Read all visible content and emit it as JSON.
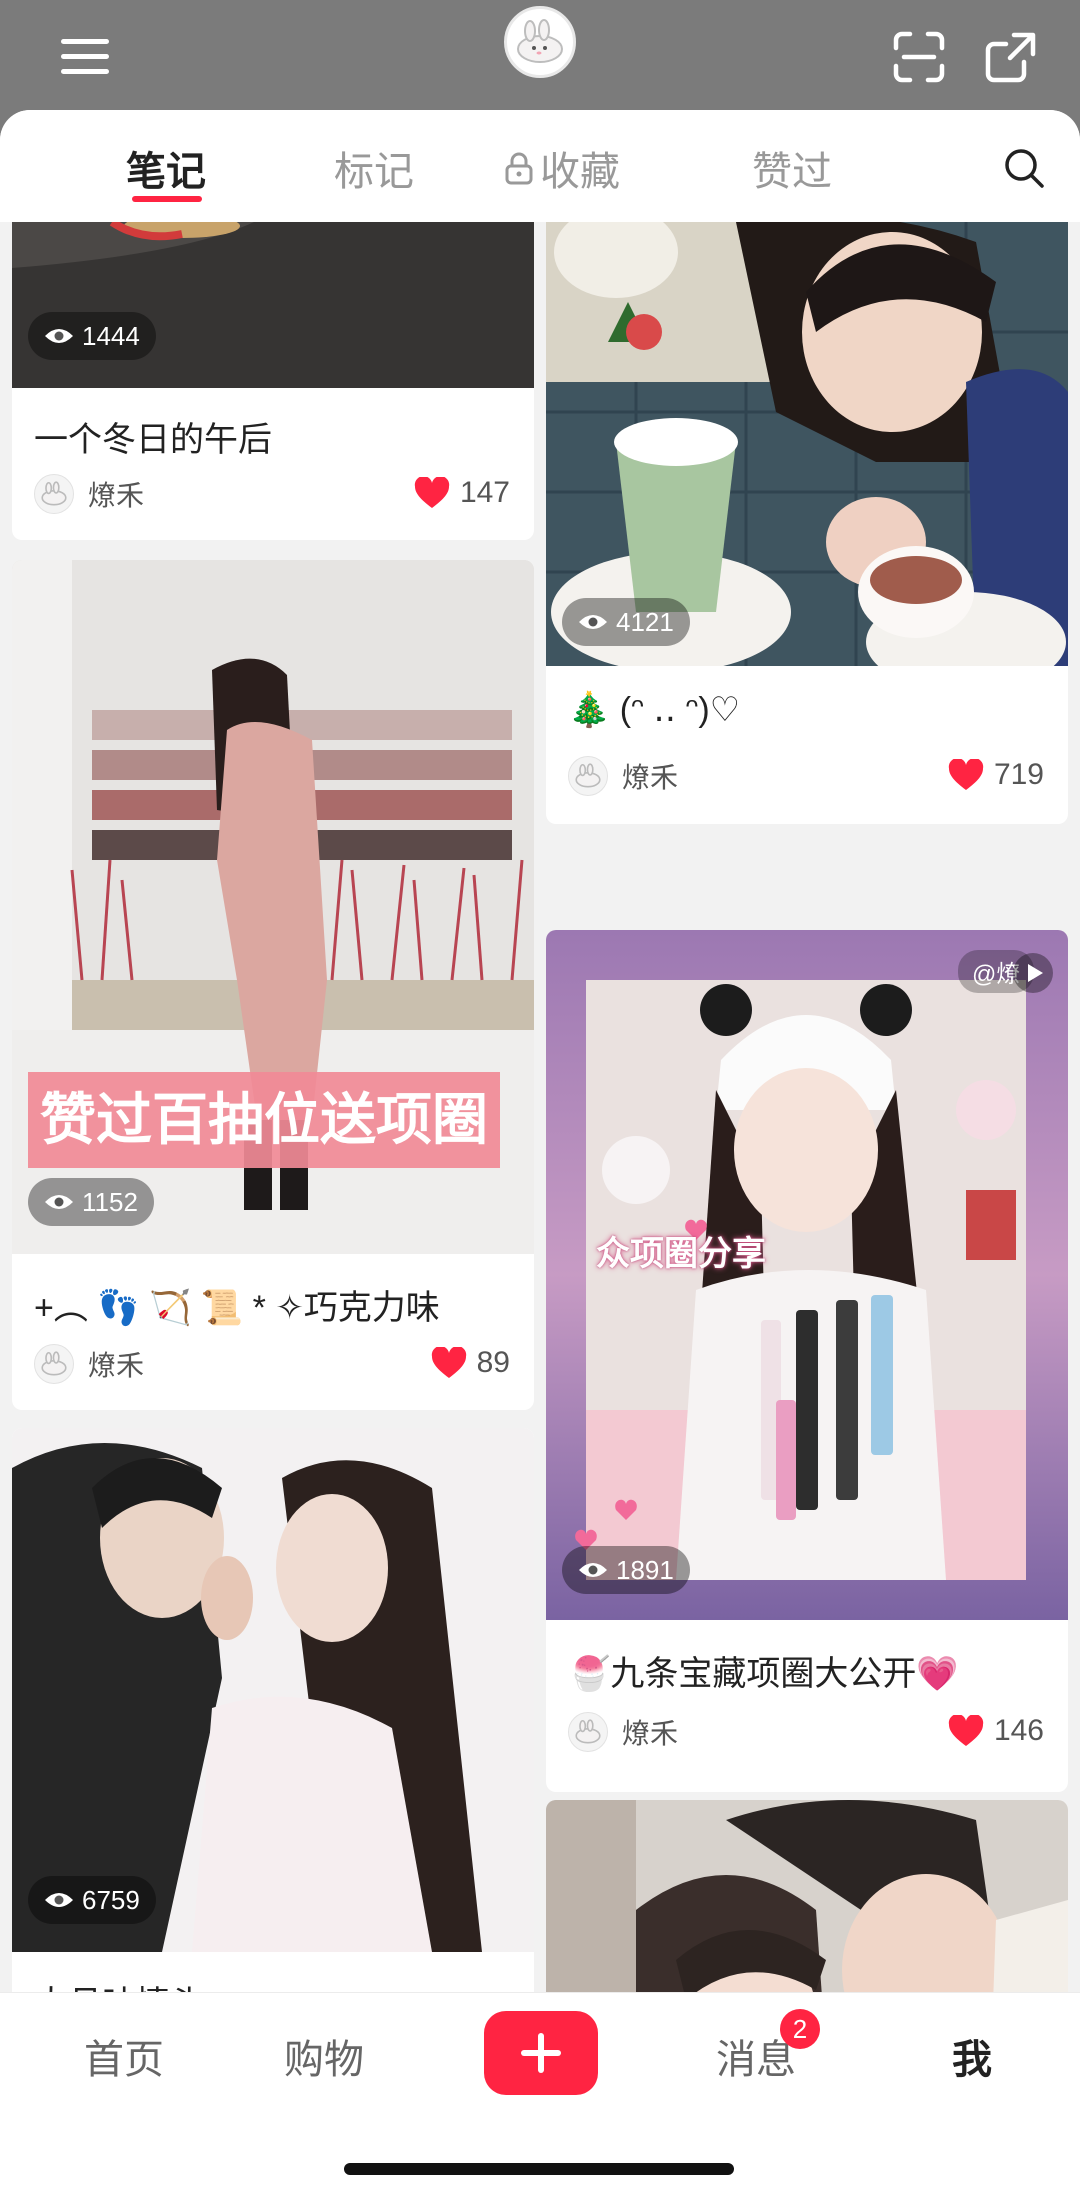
{
  "header": {
    "menu_icon": "menu-icon",
    "avatar_icon": "bunny-avatar-icon",
    "scan_icon": "scan-icon",
    "share_icon": "share-icon"
  },
  "tabs": {
    "items": [
      {
        "label": "笔记",
        "active": true
      },
      {
        "label": "标记",
        "active": false
      },
      {
        "label": "收藏",
        "active": false,
        "icon": "lock-icon"
      },
      {
        "label": "赞过",
        "active": false
      }
    ],
    "search_icon": "search-icon"
  },
  "colors": {
    "accent": "#ff2442",
    "topbar_bg": "#7b7b7b",
    "page_bg": "#f2f2f2"
  },
  "feed": {
    "left": [
      {
        "title": "一个冬日的午后",
        "author": "燎禾",
        "likes": "147",
        "views": "1444"
      },
      {
        "title": "+︵ 👣 🏹 📜 * ✧巧克力味",
        "author": "燎禾",
        "likes": "89",
        "views": "1152",
        "overlay": "赞过百抽位送项圈"
      },
      {
        "title": "大月味情头",
        "views": "6759"
      }
    ],
    "right": [
      {
        "title": "🎄 (ᵔ ‥ ᵔ)♡",
        "author": "燎禾",
        "likes": "719",
        "views": "4121"
      },
      {
        "title": "🍧九条宝藏项圈大公开💗",
        "author": "燎禾",
        "likes": "146",
        "views": "1891",
        "overlay": "众项圈分享",
        "tag": "@燎"
      },
      {
        "title": ""
      }
    ]
  },
  "bottom_nav": {
    "items": [
      {
        "label": "首页",
        "active": false
      },
      {
        "label": "购物",
        "active": false
      },
      {
        "label": "消息",
        "active": false,
        "badge": "2"
      },
      {
        "label": "我",
        "active": true
      }
    ],
    "plus_icon": "plus-icon"
  }
}
